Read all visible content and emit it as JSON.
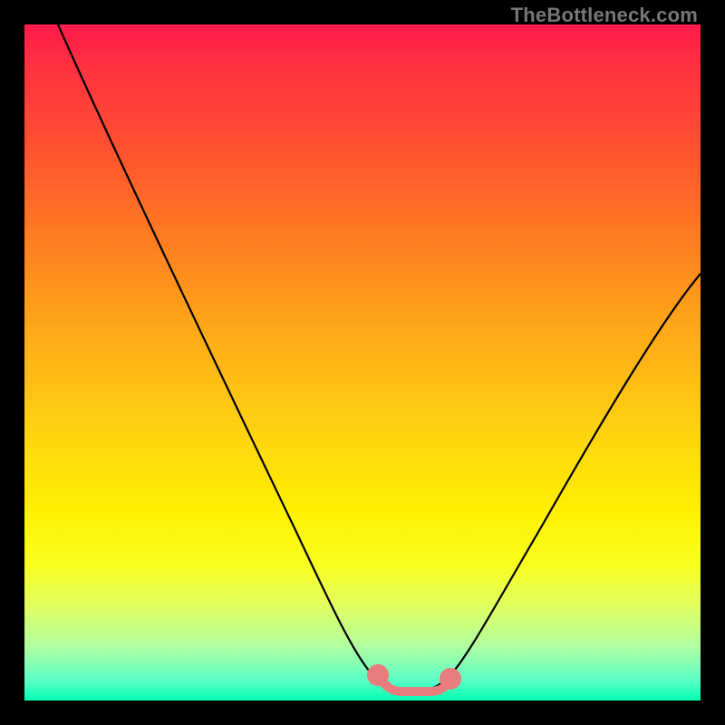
{
  "watermark": "TheBottleneck.com",
  "chart_data": {
    "type": "line",
    "title": "",
    "xlabel": "",
    "ylabel": "",
    "xlim": [
      0,
      100
    ],
    "ylim": [
      0,
      100
    ],
    "grid": false,
    "legend": false,
    "series": [
      {
        "name": "bottleneck-curve",
        "color": "#000000",
        "x": [
          5,
          10,
          15,
          20,
          25,
          30,
          35,
          40,
          45,
          50,
          52,
          54,
          55,
          56,
          57,
          59,
          61,
          63,
          65,
          70,
          75,
          80,
          85,
          90,
          95,
          100
        ],
        "y": [
          100,
          91,
          82,
          73,
          64,
          55,
          46,
          37,
          28,
          16,
          9,
          4,
          2,
          2,
          2,
          2,
          2,
          4,
          7,
          16,
          25,
          34,
          42,
          50,
          57,
          64
        ]
      },
      {
        "name": "optimal-range-marker",
        "color": "#e97d7d",
        "x": [
          52,
          53,
          54,
          55,
          56,
          57,
          58,
          59,
          60,
          61,
          62,
          63
        ],
        "y": [
          6,
          4,
          3,
          2,
          2,
          2,
          2,
          2,
          2,
          2,
          3,
          5
        ]
      }
    ],
    "annotations": []
  },
  "colors": {
    "background": "#000000",
    "gradient_top": "#ff1a4a",
    "gradient_bottom": "#00ffb0",
    "curve": "#000000",
    "marker": "#e97d7d",
    "watermark": "#777777"
  }
}
